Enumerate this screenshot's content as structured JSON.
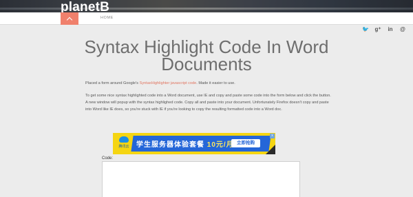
{
  "header": {
    "logo": "planetB"
  },
  "nav": {
    "toggle_icon": "chevron-up-icon",
    "home_label": "HOME",
    "accent_color": "#f0806c"
  },
  "social": [
    {
      "icon": "twitter-icon",
      "glyph": "🐦"
    },
    {
      "icon": "google-plus-icon",
      "glyph": "g⁺"
    },
    {
      "icon": "linkedin-icon",
      "glyph": "in"
    },
    {
      "icon": "email-icon",
      "glyph": "@"
    }
  ],
  "article": {
    "title": "Syntax Highlight Code In Word Documents",
    "intro_before": "Placed a form around Google's ",
    "intro_link": "SyntaxHighlighter javascript code",
    "intro_after": ". Made it easier to use.",
    "body": "To get some nice syntax highlighted code into a Word document, use IE and copy and paste some code into the form below and click the button. A new window will popup with the syntax highlighed code. Copy all and paste into your document. Unfortunately Firefox doesn't copy and paste into Word like IE does, so you're stuck with IE if you're looking to copy the resulting formatted code into a Word doc."
  },
  "ad": {
    "brand": "腾讯云",
    "slogan": "学生服务器体验套餐 ",
    "price": "10元/月",
    "cta": "立即抢购",
    "close": "x"
  },
  "form": {
    "code_label": "Code:",
    "code_value": ""
  }
}
